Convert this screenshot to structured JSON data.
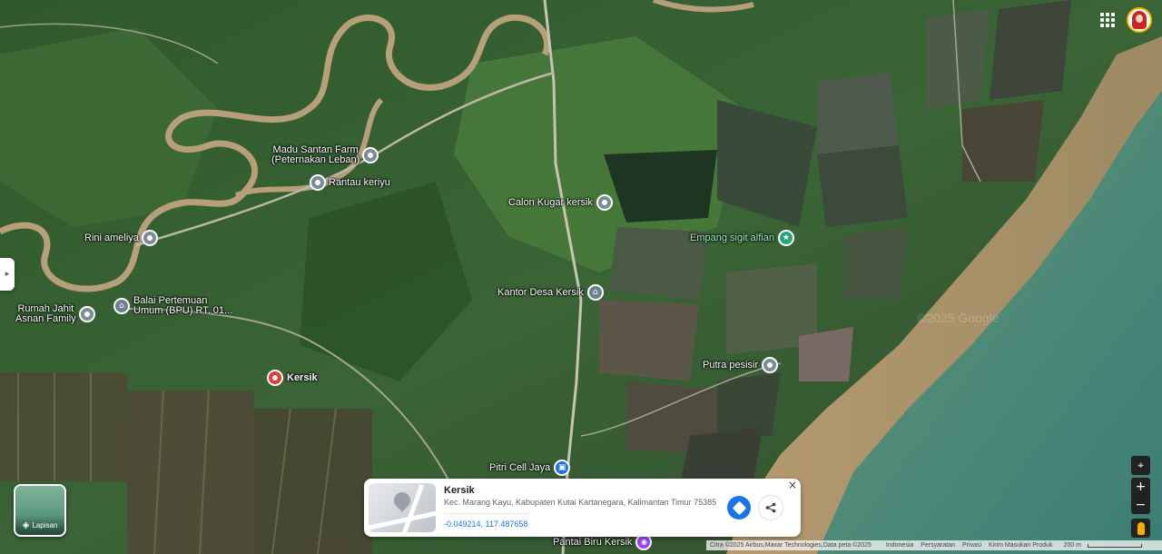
{
  "map": {
    "type": "satellite",
    "watermark": "©2025 Google"
  },
  "places": [
    {
      "id": "madu-santan",
      "name": "Madu Santan Farm (Peternakan Leban)",
      "lines": [
        "Madu Santan Farm",
        "(Peternakan Leban)"
      ],
      "icon": "pin-icon"
    },
    {
      "id": "rantau-keriyu",
      "name": "Rantau keriyu",
      "icon": "pin-icon"
    },
    {
      "id": "rini-ameliya",
      "name": "Rini ameliya",
      "icon": "pin-icon"
    },
    {
      "id": "rumah-jahit",
      "name": "Rumah Jahit Asnan Family",
      "lines": [
        "Rumah Jahit",
        "Asnan Family"
      ],
      "icon": "pin-icon"
    },
    {
      "id": "balai-pertemuan",
      "name": "Balai Pertemuan Umum (BPU) RT. 01...",
      "lines": [
        "Balai Pertemuan",
        "Umum (BPU) RT. 01..."
      ],
      "icon": "building-icon"
    },
    {
      "id": "kersik",
      "name": "Kersik",
      "icon": "red-pin-icon"
    },
    {
      "id": "calon-kugar",
      "name": "Calon Kugar kersik",
      "icon": "pin-icon"
    },
    {
      "id": "empang-sigit",
      "name": "Empang sigit alfian",
      "icon": "star-icon"
    },
    {
      "id": "kantor-desa",
      "name": "Kantor Desa Kersik",
      "icon": "building-icon"
    },
    {
      "id": "putra-pesisir",
      "name": "Putra pesisir",
      "icon": "pin-icon"
    },
    {
      "id": "pitri-cell",
      "name": "Pitri Cell Jaya",
      "icon": "shopping-bag-icon"
    },
    {
      "id": "pantai-biru",
      "name": "Pantai Biru Kersik",
      "icon": "camera-icon"
    }
  ],
  "layers": {
    "label": "Lapisan",
    "icon": "layers-icon"
  },
  "place_card": {
    "name": "Kersik",
    "address": "Kec. Marang Kayu, Kabupaten Kutai Kartanegara, Kalimantan Timur 75385",
    "coords": "-0.049214, 117.487658",
    "close": "×"
  },
  "attribution": {
    "imagery": "Citra ©2025 Airbus,Maxar Technologies,Data peta ©2025",
    "country": "Indonesia",
    "terms": "Persyaratan",
    "privacy": "Privasi",
    "feedback": "Kirim Masukan Produk",
    "scale": "200 m"
  },
  "controls": {
    "locate": "⌖",
    "zoom_in": "+",
    "zoom_out": "−",
    "collapse": "▸"
  }
}
